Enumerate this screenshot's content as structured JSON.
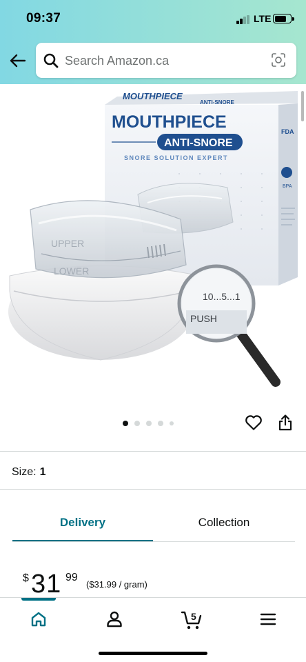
{
  "status_bar": {
    "time": "09:37",
    "network": "LTE"
  },
  "search": {
    "placeholder": "Search Amazon.ca"
  },
  "product_image": {
    "brand_line": "MOUTHPIECE",
    "subtitle": "ANTI-SNORE",
    "tagline": "SNORE SOLUTION EXPERT",
    "box_top": "MOUTHPIECE",
    "box_top_sub": "ANTI-SNORE",
    "label_upper": "UPPER",
    "label_lower": "LOWER",
    "magnifier_numbers": "10...5...1",
    "magnifier_label": "PUSH",
    "side_badge_1": "FDA",
    "side_badge_2": "BPA"
  },
  "carousel": {
    "count": 5,
    "active_index": 0
  },
  "size": {
    "label": "Size:",
    "value": "1"
  },
  "tabs": {
    "delivery": "Delivery",
    "collection": "Collection",
    "active": "delivery"
  },
  "price": {
    "currency": "$",
    "whole": "31",
    "fraction": "99",
    "unit_price": "($31.99 / gram)"
  },
  "bottom_nav": {
    "cart_count": "5",
    "active": "home"
  },
  "colors": {
    "accent": "#007185",
    "header_start": "#82d8e3",
    "header_end": "#a6e6cf",
    "box_blue": "#1f4f8f"
  }
}
